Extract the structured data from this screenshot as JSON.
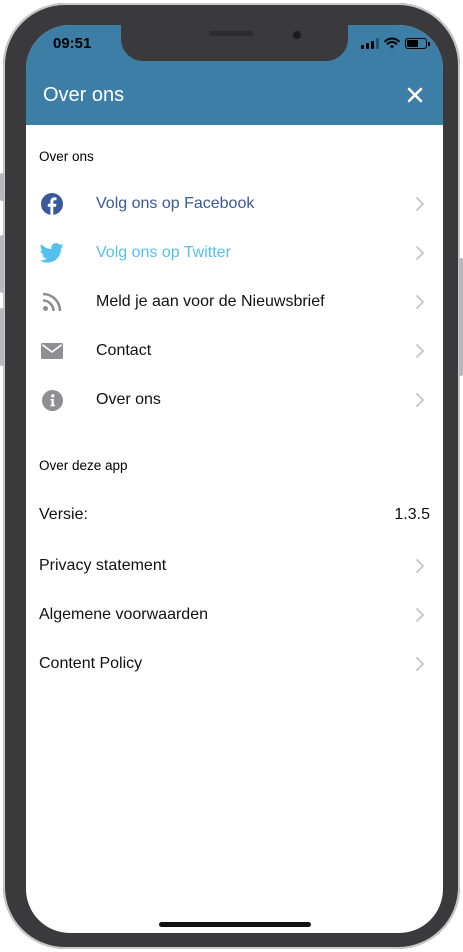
{
  "status_bar": {
    "time": "09:51"
  },
  "header": {
    "title": "Over ons",
    "close_icon": "close-icon"
  },
  "section_about": {
    "title": "Over ons",
    "items": [
      {
        "label": "Volg ons op Facebook",
        "icon": "facebook-icon",
        "color": "#3b5998"
      },
      {
        "label": "Volg ons op Twitter",
        "icon": "twitter-icon",
        "color": "#55c0ee"
      },
      {
        "label": "Meld je aan voor de Nieuwsbrief",
        "icon": "rss-icon",
        "color": "#111111"
      },
      {
        "label": "Contact",
        "icon": "mail-icon",
        "color": "#111111"
      },
      {
        "label": "Over ons",
        "icon": "info-icon",
        "color": "#111111"
      }
    ]
  },
  "section_app": {
    "title": "Over deze app",
    "version_label": "Versie:",
    "version_value": "1.3.5",
    "items": [
      {
        "label": "Privacy statement"
      },
      {
        "label": "Algemene voorwaarden"
      },
      {
        "label": "Content Policy"
      }
    ]
  },
  "colors": {
    "header": "#3d7ea6",
    "facebook": "#3b5998",
    "twitter": "#55c0ee",
    "icon_gray": "#8e8e93",
    "chevron": "#c4c4c7"
  }
}
